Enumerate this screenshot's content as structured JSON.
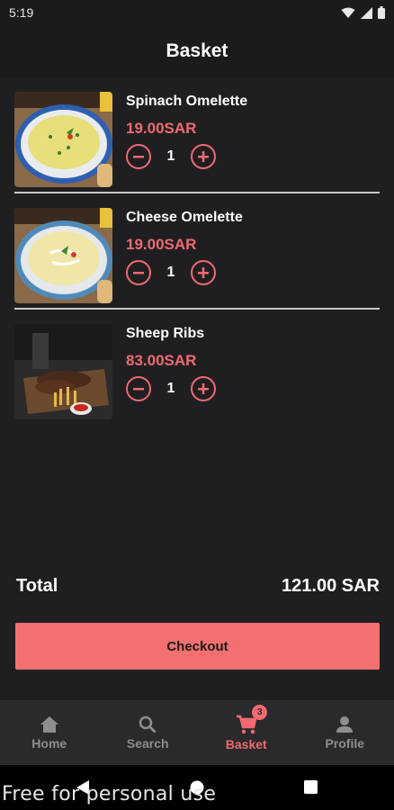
{
  "status_bar": {
    "time": "5:19"
  },
  "app_bar": {
    "title": "Basket"
  },
  "items": [
    {
      "name": "Spinach Omelette",
      "price": "19.00SAR",
      "quantity": "1"
    },
    {
      "name": "Cheese Omelette",
      "price": "19.00SAR",
      "quantity": "1"
    },
    {
      "name": "Sheep Ribs",
      "price": "83.00SAR",
      "quantity": "1"
    }
  ],
  "total": {
    "label": "Total",
    "value": "121.00 SAR"
  },
  "checkout": {
    "label": "Checkout"
  },
  "bottom_nav": {
    "items": [
      {
        "label": "Home",
        "icon": "home-icon"
      },
      {
        "label": "Search",
        "icon": "search-icon"
      },
      {
        "label": "Basket",
        "icon": "cart-icon",
        "badge": "3",
        "active": true
      },
      {
        "label": "Profile",
        "icon": "person-icon"
      }
    ]
  },
  "watermark": "Free for personal use",
  "colors": {
    "accent": "#f06a70",
    "checkout": "#f47070",
    "background": "#1f1f22"
  }
}
